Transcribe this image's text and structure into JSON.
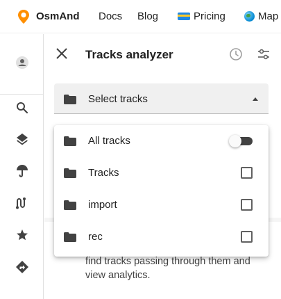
{
  "nav": {
    "brand": "OsmAnd",
    "links": [
      {
        "label": "Docs"
      },
      {
        "label": "Blog"
      },
      {
        "label": "Pricing",
        "icon": "credit-card-icon"
      },
      {
        "label": "Map",
        "icon": "globe-icon"
      }
    ],
    "logo_color": "#FF8F00"
  },
  "sidebar": {
    "items": [
      {
        "icon": "account-icon"
      },
      {
        "icon": "search-icon"
      },
      {
        "icon": "layers-icon"
      },
      {
        "icon": "weather-icon"
      },
      {
        "icon": "route-icon"
      },
      {
        "icon": "star-icon"
      },
      {
        "icon": "navigation-icon"
      }
    ]
  },
  "panel": {
    "title": "Tracks analyzer",
    "close_icon": "close-icon",
    "history_icon": "history-icon",
    "filter_icon": "filter-icon"
  },
  "select": {
    "label": "Select tracks",
    "icon": "folder-icon"
  },
  "dropdown": {
    "items": [
      {
        "label": "All tracks",
        "control": "toggle",
        "checked": false
      },
      {
        "label": "Tracks",
        "control": "checkbox",
        "checked": false
      },
      {
        "label": "import",
        "control": "checkbox",
        "checked": false
      },
      {
        "label": "rec",
        "control": "checkbox",
        "checked": false
      }
    ]
  },
  "hint": {
    "text": "find tracks passing through them and view analytics."
  },
  "colors": {
    "accent": "#FF8F00",
    "icon": "#424242",
    "folder": "#424242"
  }
}
